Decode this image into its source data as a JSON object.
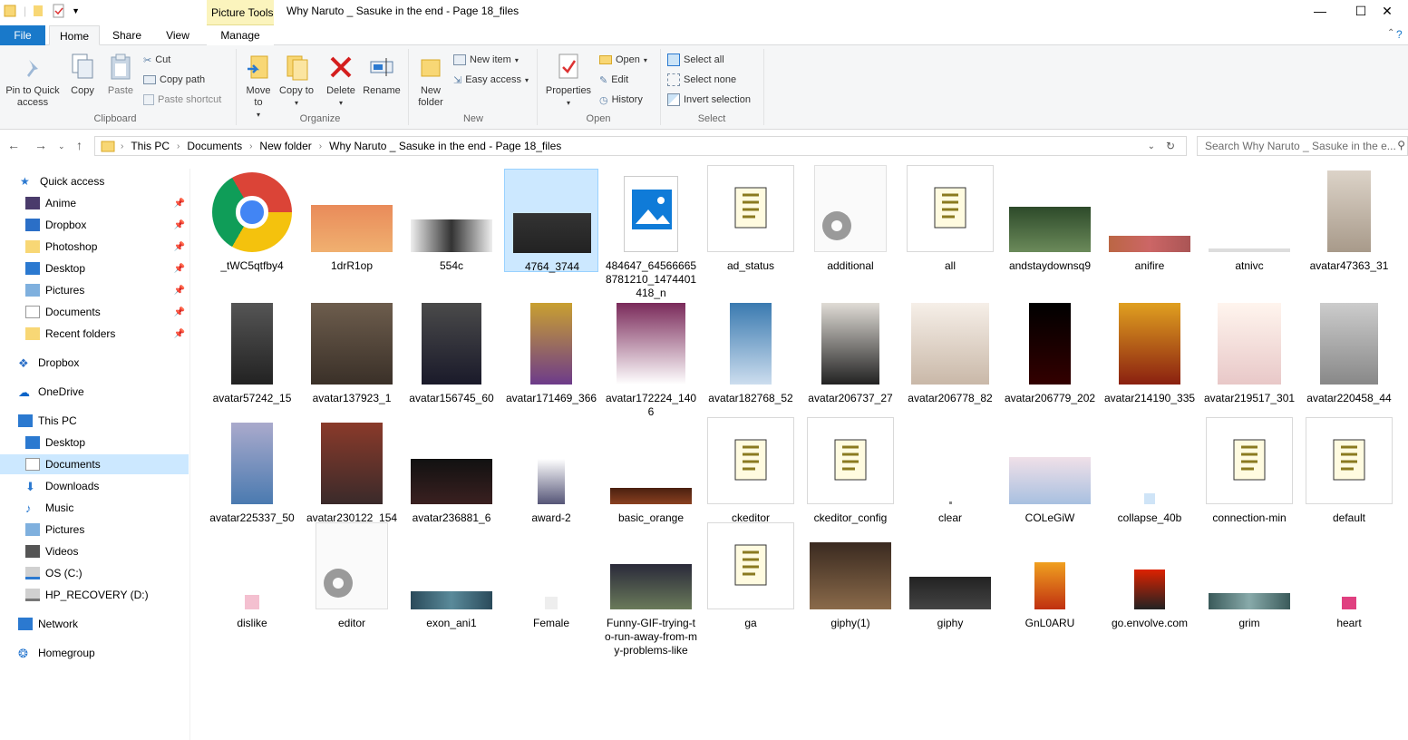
{
  "window": {
    "title": "Why Naruto _ Sasuke in the end - Page 18_files",
    "context_tab": "Picture Tools",
    "controls": {
      "minimize": "—",
      "maximize": "☐",
      "close": "✕"
    }
  },
  "tabs": {
    "file": "File",
    "home": "Home",
    "share": "Share",
    "view": "View",
    "manage": "Manage"
  },
  "ribbon": {
    "clipboard": {
      "pin": "Pin to Quick access",
      "copy": "Copy",
      "paste": "Paste",
      "cut": "Cut",
      "copy_path": "Copy path",
      "paste_shortcut": "Paste shortcut",
      "label": "Clipboard"
    },
    "organize": {
      "move_to": "Move to",
      "copy_to": "Copy to",
      "delete": "Delete",
      "rename": "Rename",
      "label": "Organize"
    },
    "new": {
      "new_folder": "New folder",
      "new_item": "New item",
      "easy_access": "Easy access",
      "label": "New"
    },
    "open": {
      "properties": "Properties",
      "open": "Open",
      "edit": "Edit",
      "history": "History",
      "label": "Open"
    },
    "select": {
      "select_all": "Select all",
      "select_none": "Select none",
      "invert": "Invert selection",
      "label": "Select"
    }
  },
  "address": {
    "crumbs": [
      "This PC",
      "Documents",
      "New folder",
      "Why Naruto _ Sasuke in the end - Page 18_files"
    ],
    "search_placeholder": "Search Why Naruto _ Sasuke in the e..."
  },
  "nav": {
    "quick_access": "Quick access",
    "quick_items": [
      "Anime",
      "Dropbox",
      "Photoshop",
      "Desktop",
      "Pictures",
      "Documents",
      "Recent folders"
    ],
    "dropbox": "Dropbox",
    "onedrive": "OneDrive",
    "this_pc": "This PC",
    "pc_items": [
      "Desktop",
      "Documents",
      "Downloads",
      "Music",
      "Pictures",
      "Videos",
      "OS (C:)",
      "HP_RECOVERY (D:)"
    ],
    "network": "Network",
    "homegroup": "Homegroup"
  },
  "files": [
    "_tWC5qtfby4",
    "1drR1op",
    "554c",
    "4764_3744",
    "484647_645666658781210_1474401418_n",
    "ad_status",
    "additional",
    "all",
    "andstaydownsq9",
    "anifire",
    "atnivc",
    "avatar47363_31",
    "avatar57242_15",
    "avatar137923_1",
    "avatar156745_60",
    "avatar171469_366",
    "avatar172224_1406",
    "avatar182768_52",
    "avatar206737_27",
    "avatar206778_82",
    "avatar206779_202",
    "avatar214190_335",
    "avatar219517_301",
    "avatar220458_44",
    "avatar225337_50",
    "avatar230122_154",
    "avatar236881_6",
    "award-2",
    "basic_orange",
    "ckeditor",
    "ckeditor_config",
    "clear",
    "COLeGiW",
    "collapse_40b",
    "connection-min",
    "default",
    "dislike",
    "editor",
    "exon_ani1",
    "Female",
    "Funny-GIF-trying-to-run-away-from-my-problems-like",
    "ga",
    "giphy(1)",
    "giphy",
    "GnL0ARU",
    "go.envolve.com",
    "grim",
    "heart"
  ]
}
